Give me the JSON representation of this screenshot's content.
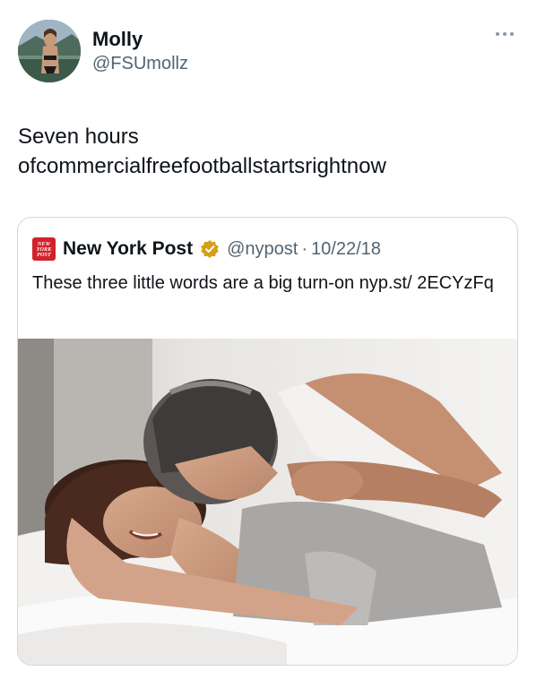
{
  "author": {
    "name": "Molly",
    "handle": "@FSUmollz",
    "avatar_icon": "profile-photo"
  },
  "tweet": {
    "text": "Seven hours\nofcommercialfreefootballstartsrightnow"
  },
  "more_icon": "more-options-icon",
  "quoted_tweet": {
    "logo_text": "NEW YORK POST",
    "name": "New York Post",
    "verified_color": "#d4a017",
    "handle": "@nypost",
    "separator": "·",
    "date": "10/22/18",
    "text": "These three little words are a big turn-on nyp.st/ 2ECYzFq",
    "media": "photo of a couple embracing in bed"
  },
  "colors": {
    "text": "#0f1419",
    "secondary": "#536471",
    "border": "#cfd9de",
    "nyp_red": "#d1232a"
  }
}
